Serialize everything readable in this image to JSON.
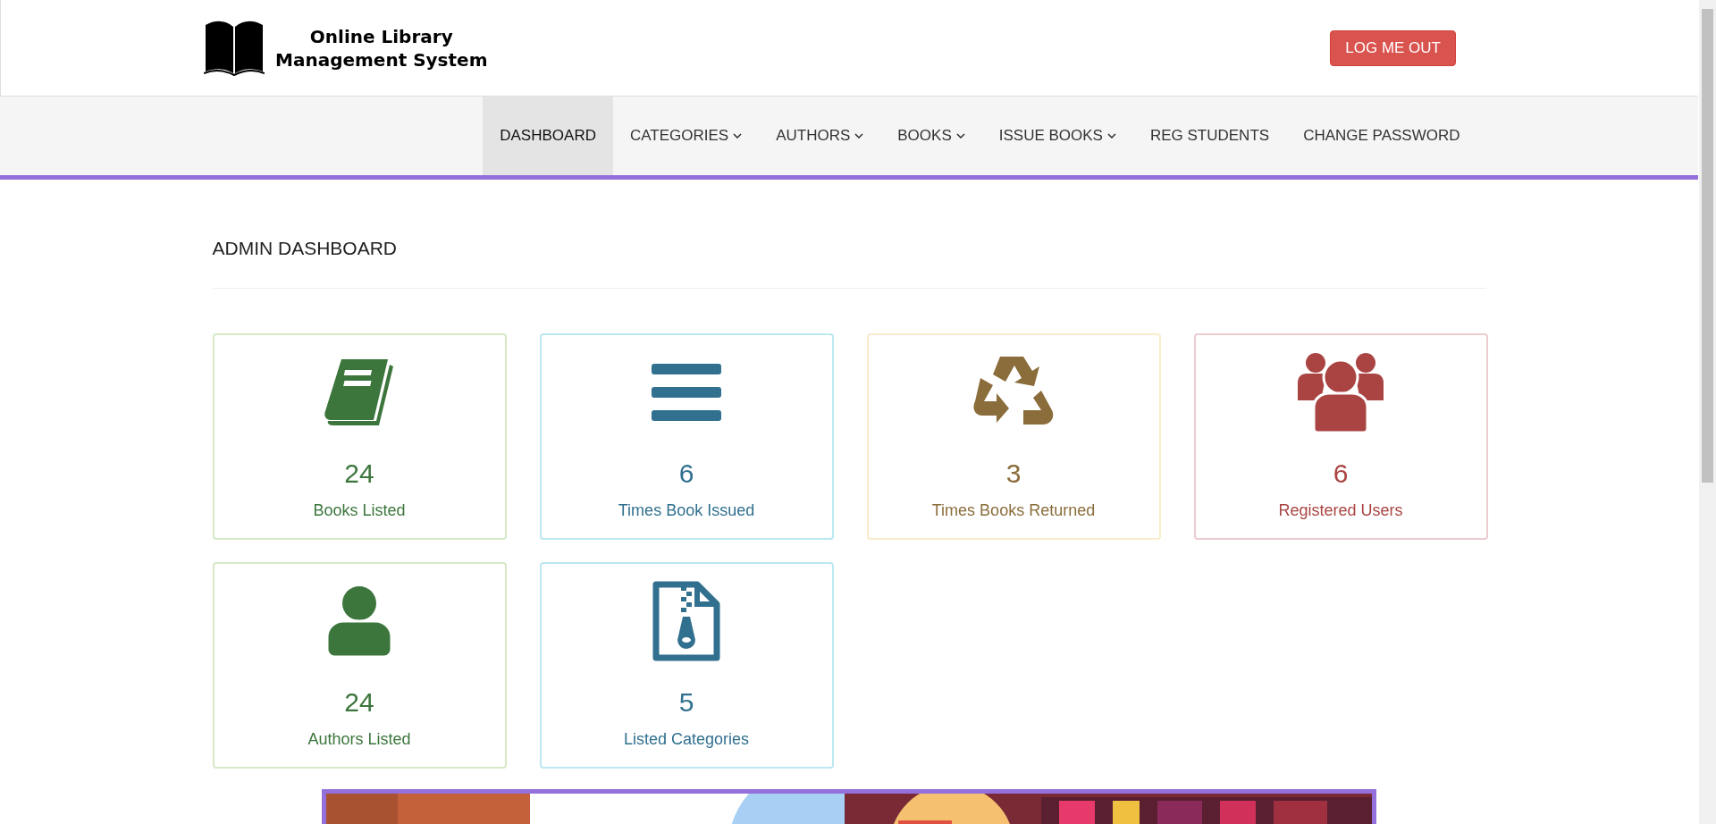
{
  "header": {
    "title_lines": [
      "Online Library",
      "Management System"
    ],
    "logout_button": "LOG ME OUT"
  },
  "nav": [
    {
      "label": "DASHBOARD",
      "selected": true,
      "dropdown": false
    },
    {
      "label": "CATEGORIES",
      "selected": false,
      "dropdown": true
    },
    {
      "label": "AUTHORS",
      "selected": false,
      "dropdown": true
    },
    {
      "label": "BOOKS",
      "selected": false,
      "dropdown": true
    },
    {
      "label": "ISSUE BOOKS",
      "selected": false,
      "dropdown": true
    },
    {
      "label": "REG STUDENTS",
      "selected": false,
      "dropdown": false
    },
    {
      "label": "CHANGE PASSWORD",
      "selected": false,
      "dropdown": false
    }
  ],
  "page_title": "ADMIN DASHBOARD",
  "cards": [
    {
      "kind": "book",
      "color": "#3c763d",
      "count": "24",
      "label": "Books Listed"
    },
    {
      "kind": "bars",
      "color": "#31708f",
      "count": "6",
      "label": "Times Book Issued"
    },
    {
      "kind": "recycle",
      "color": "#8a6d3b",
      "count": "3",
      "label": "Times Books Returned"
    },
    {
      "kind": "users",
      "color": "#a94442",
      "count": "6",
      "label": "Registered Users"
    },
    {
      "kind": "user",
      "color": "#3c763d",
      "count": "24",
      "label": "Authors Listed"
    },
    {
      "kind": "zipfile",
      "color": "#31708f",
      "count": "5",
      "label": "Listed Categories"
    }
  ]
}
